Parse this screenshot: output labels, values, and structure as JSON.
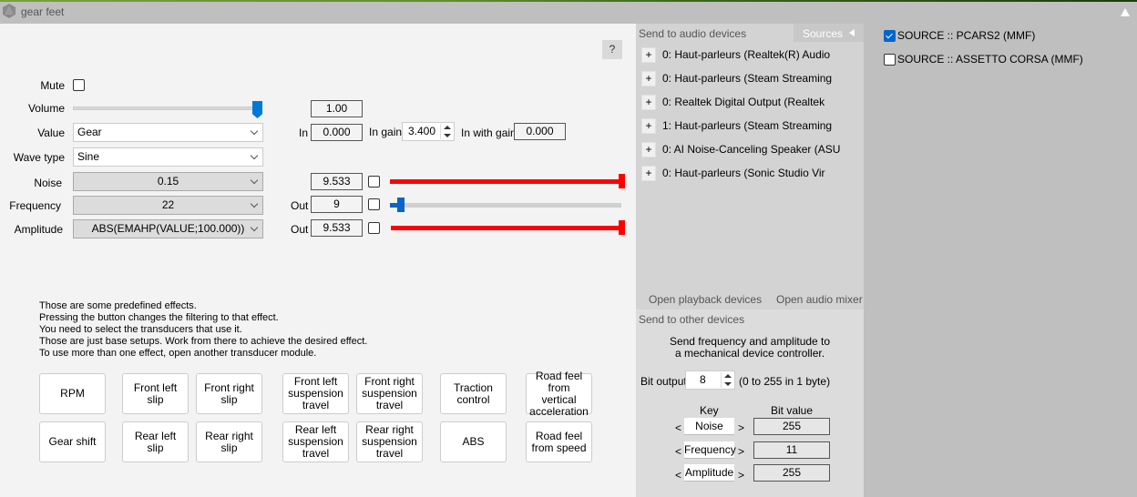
{
  "window": {
    "title": "gear feet",
    "help_label": "?"
  },
  "controls": {
    "mute_label": "Mute",
    "mute_checked": false,
    "volume_label": "Volume",
    "volume_value": "1.00",
    "volume_fraction": 1.0,
    "value_label": "Value",
    "value_selected": "Gear",
    "in_label": "In",
    "in_value": "0.000",
    "in_gain_label": "In gain",
    "in_gain_value": "3.400",
    "in_with_gain_label": "In with gain",
    "in_with_gain_value": "0.000",
    "wave_type_label": "Wave type",
    "wave_type_selected": "Sine",
    "noise_label": "Noise",
    "noise_selected": "0.15",
    "noise_out_value": "9.533",
    "noise_bar_fraction": 1.0,
    "frequency_label": "Frequency",
    "frequency_selected": "22",
    "frequency_out_label": "Out",
    "frequency_out_value": "9",
    "frequency_bar_fraction": 0.04,
    "amplitude_label": "Amplitude",
    "amplitude_selected": "ABS(EMAHP(VALUE;100.000))",
    "amplitude_out_label": "Out",
    "amplitude_out_value": "9.533",
    "amplitude_bar_fraction": 1.0
  },
  "info_lines": [
    "Those are some predefined effects.",
    "Pressing the button changes the filtering to that effect.",
    "You need to select the transducers that use it.",
    "Those are just base setups. Work from there to achieve the desired effect.",
    "To use more than one effect, open another transducer module."
  ],
  "effects": [
    "RPM",
    "Front left slip",
    "Front right slip",
    "Front left suspension travel",
    "Front right suspension travel",
    "Traction control",
    "Road feel from vertical acceleration",
    "Gear shift",
    "Rear left slip",
    "Rear right slip",
    "Rear left suspension travel",
    "Rear right suspension travel",
    "ABS",
    "Road feel from speed"
  ],
  "audio": {
    "header": "Send to audio devices",
    "sources_tab": "Sources",
    "add_label": "+",
    "devices": [
      "0: Haut-parleurs (Realtek(R) Audio",
      "0: Haut-parleurs (Steam Streaming",
      "0: Realtek Digital Output (Realtek",
      "1: Haut-parleurs (Steam Streaming",
      "0: AI Noise-Canceling Speaker (ASU",
      "0: Haut-parleurs (Sonic Studio Vir"
    ],
    "open_playback": "Open playback devices",
    "open_mixer": "Open audio mixer"
  },
  "other": {
    "header": "Send to other devices",
    "desc_line1": "Send frequency and amplitude to",
    "desc_line2": "a mechanical device controller.",
    "bit_output_label": "Bit output",
    "bit_output_value": "8",
    "bit_output_hint": "(0 to 255 in 1 byte)",
    "key_header": "Key",
    "bit_value_header": "Bit value",
    "rows": [
      {
        "key": "Noise",
        "value": "255"
      },
      {
        "key": "Frequency",
        "value": "11"
      },
      {
        "key": "Amplitude",
        "value": "255"
      }
    ],
    "prev": "<",
    "next": ">"
  },
  "sources": [
    {
      "label": "SOURCE :: PCARS2 (MMF)",
      "checked": true
    },
    {
      "label": "SOURCE :: ASSETTO CORSA (MMF)",
      "checked": false
    }
  ]
}
